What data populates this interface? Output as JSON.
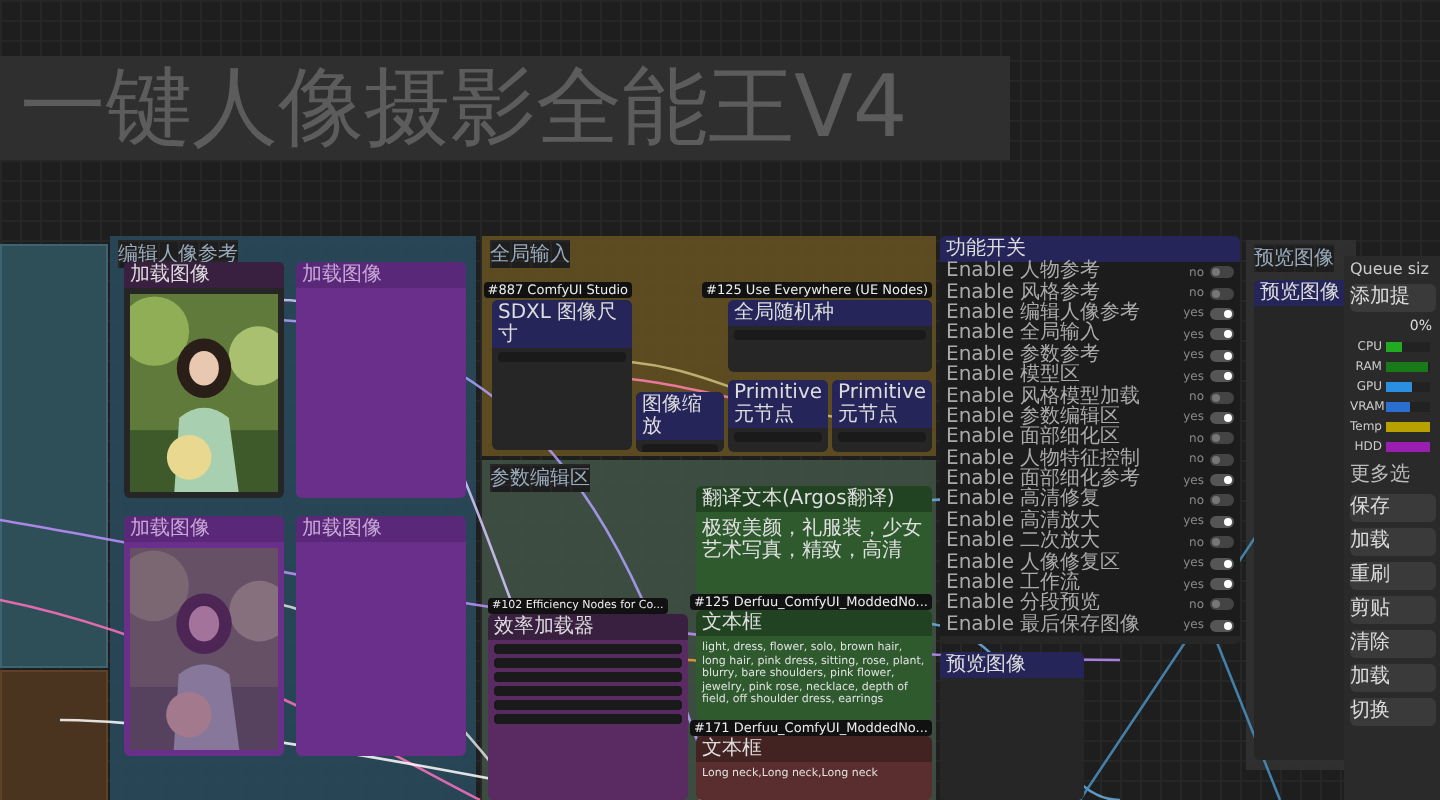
{
  "title": "一键人像摄影全能王V4",
  "groups": [
    {
      "title": "编辑人像参考"
    },
    {
      "title": "全局输入"
    },
    {
      "title": "参数编辑区"
    },
    {
      "title": "预览图像"
    }
  ],
  "image_nodes": [
    {
      "title": "加载图像",
      "bypassed": false
    },
    {
      "title": "加载图像",
      "bypassed": true
    },
    {
      "title": "加载图像",
      "bypassed": true
    },
    {
      "title": "加载图像",
      "bypassed": true
    }
  ],
  "input_nodes": [
    {
      "title": "SDXL 图像尺寸",
      "badge": "#887 ComfyUI Studio"
    },
    {
      "title": "图像缩放"
    },
    {
      "title": "全局随机种",
      "badge": "#125 Use Everywhere (UE Nodes)"
    },
    {
      "title": "Primitive元节点"
    },
    {
      "title": "Primitive元节点"
    }
  ],
  "param_nodes": [
    {
      "title": "翻译文本(Argos翻译)",
      "text": "极致美颜，礼服装，少女艺术写真，精致，高清",
      "color": "#2e5a2e"
    },
    {
      "title": "文本框",
      "badge": "#125 Derfuu_ComfyUI_ModdedNo...",
      "text": "light, dress, flower, solo, brown hair, long hair, pink dress, sitting, rose, plant, blurry, bare shoulders, pink flower, jewelry, pink rose, necklace, depth of field, off shoulder dress, earrings",
      "color": "#2e5a2e"
    },
    {
      "title": "文本框",
      "badge": "#171 Derfuu_ComfyUI_ModdedNo...",
      "text": "Long neck,Long neck,Long neck",
      "color": "#5a2e2e"
    }
  ],
  "loader_node": {
    "title": "效率加载器",
    "badge": "#102 Efficiency Nodes for Co..."
  },
  "switch_node": {
    "title": "功能开关",
    "rows": [
      {
        "label": "Enable 人物参考",
        "value": "no",
        "on": false
      },
      {
        "label": "Enable 风格参考",
        "value": "no",
        "on": false
      },
      {
        "label": "Enable 编辑人像参考",
        "value": "yes",
        "on": true
      },
      {
        "label": "Enable 全局输入",
        "value": "yes",
        "on": true
      },
      {
        "label": "Enable 参数参考",
        "value": "yes",
        "on": true
      },
      {
        "label": "Enable 模型区",
        "value": "yes",
        "on": true
      },
      {
        "label": "Enable 风格模型加载",
        "value": "no",
        "on": false
      },
      {
        "label": "Enable 参数编辑区",
        "value": "yes",
        "on": true
      },
      {
        "label": "Enable 面部细化区",
        "value": "no",
        "on": false
      },
      {
        "label": "Enable 人物特征控制",
        "value": "no",
        "on": false
      },
      {
        "label": "Enable 面部细化参考",
        "value": "yes",
        "on": true
      },
      {
        "label": "Enable 高清修复",
        "value": "no",
        "on": false
      },
      {
        "label": "Enable 高清放大",
        "value": "yes",
        "on": true
      },
      {
        "label": "Enable 二次放大",
        "value": "no",
        "on": false
      },
      {
        "label": "Enable 人像修复区",
        "value": "yes",
        "on": true
      },
      {
        "label": "Enable 工作流",
        "value": "yes",
        "on": true
      },
      {
        "label": "Enable 分段预览",
        "value": "no",
        "on": false
      },
      {
        "label": "Enable 最后保存图像",
        "value": "yes",
        "on": true
      }
    ]
  },
  "preview_nodes": [
    {
      "title": "预览图像"
    },
    {
      "title": "预览图像"
    }
  ],
  "queue_panel": {
    "title": "Queue siz",
    "prompt_button": "添加提",
    "progress": "0%",
    "meters": [
      {
        "label": "CPU",
        "level": 0.35,
        "color": "#22aa22"
      },
      {
        "label": "RAM",
        "level": 0.95,
        "color": "#1a7a1a"
      },
      {
        "label": "GPU",
        "level": 0.6,
        "color": "#2a8fe0"
      },
      {
        "label": "VRAM",
        "level": 0.55,
        "color": "#2a6fd0"
      },
      {
        "label": "Temp",
        "level": 1,
        "color": "#b8a000"
      },
      {
        "label": "HDD",
        "level": 1,
        "color": "#9a1fb0"
      }
    ],
    "more": "更多选",
    "buttons": [
      "保存",
      "加载",
      "重刷",
      "剪贴",
      "清除",
      "加载",
      "切换"
    ]
  }
}
